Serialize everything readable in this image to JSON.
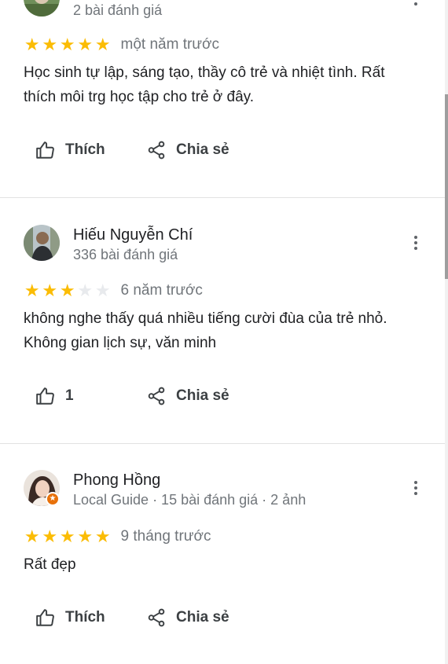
{
  "reviews": [
    {
      "name": "",
      "meta": "2 bài đánh giá",
      "rating": 5,
      "time": "một năm trước",
      "text": "Học sinh tự lập, sáng tạo, thầy cô trẻ và nhiệt tình. Rất thích môi trg học tập cho trẻ ở đây.",
      "like_label": "Thích",
      "share_label": "Chia sẻ"
    },
    {
      "name": "Hiếu Nguyễn Chí",
      "meta": "336 bài đánh giá",
      "rating": 3,
      "time": "6 năm trước",
      "text": "không nghe thấy quá nhiều tiếng cười đùa của trẻ nhỏ. Không gian lịch sự, văn minh",
      "like_label": "1",
      "share_label": "Chia sẻ"
    },
    {
      "name": "Phong Hồng",
      "meta": "Local Guide · 15 bài đánh giá · 2 ảnh",
      "rating": 5,
      "time": "9 tháng trước",
      "text": "Rất đẹp",
      "like_label": "Thích",
      "share_label": "Chia sẻ"
    }
  ],
  "colors": {
    "star": "#fbbc04",
    "star_empty": "#e8eaed",
    "local_guide_badge": "#e8710a"
  },
  "icons": {
    "like": "thumbs-up-icon",
    "share": "share-icon",
    "more": "more-vertical-icon"
  }
}
